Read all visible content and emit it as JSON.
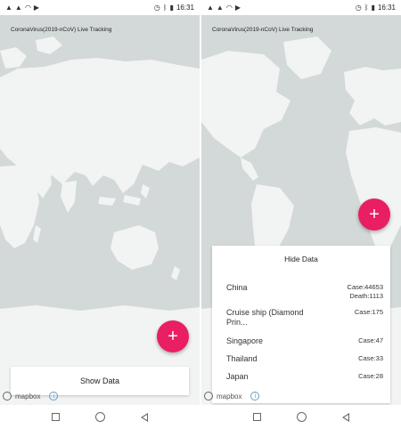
{
  "status_bar": {
    "left_icons": [
      "signal-icon",
      "signal-icon",
      "wifi-icon",
      "app-icon"
    ],
    "right_icons": [
      "alarm-icon",
      "bluetooth-icon",
      "battery-icon"
    ],
    "time": "16:31"
  },
  "app": {
    "title": "CoronaVirus(2019-nCoV) Live Tracking",
    "fab_icon": "plus-icon",
    "fab_symbol": "+",
    "show_data_label": "Show Data",
    "hide_data_label": "Hide Data"
  },
  "map": {
    "attribution": "mapbox",
    "info_symbol": "i",
    "land_color": "#f2f3f3",
    "water_color": "#d3d8d8"
  },
  "data_rows": [
    {
      "country": "China",
      "cases": "Case:44653",
      "deaths": "Death:1113"
    },
    {
      "country": "Cruise ship (Diamond Prin...",
      "cases": "Case:175"
    },
    {
      "country": "Singapore",
      "cases": "Case:47"
    },
    {
      "country": "Thailand",
      "cases": "Case:33"
    },
    {
      "country": "Japan",
      "cases": "Case:28"
    }
  ],
  "accent_color": "#e91e63",
  "nav_bar": {
    "icons": [
      "square-icon",
      "circle-icon",
      "back-triangle-icon"
    ]
  }
}
